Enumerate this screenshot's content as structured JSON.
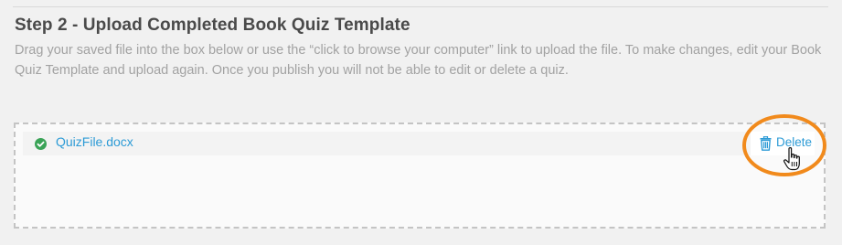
{
  "step": {
    "title": "Step 2 - Upload Completed Book Quiz Template",
    "description": "Drag your saved file into the box below or use the “click to browse your computer” link to upload the file. To make changes, edit your Book Quiz Template and upload again. Once you publish you will not be able to edit or delete a quiz."
  },
  "upload": {
    "file_name": "QuizFile.docx",
    "file_status_icon": "check-circle-icon",
    "delete_label": "Delete",
    "delete_icon": "trash-icon"
  },
  "colors": {
    "link": "#2d9bd6",
    "success": "#3aa357",
    "highlight": "#f18a1c",
    "title": "#4a4a4a",
    "muted_text": "#a2a2a2"
  }
}
